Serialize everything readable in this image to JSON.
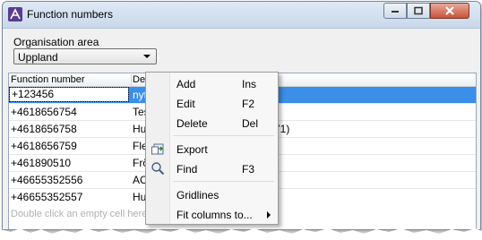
{
  "window": {
    "title": "Function numbers"
  },
  "org": {
    "label": "Organisation area",
    "selected": "Uppland"
  },
  "grid": {
    "col1": "Function number",
    "col2": "Des",
    "rows": [
      {
        "number": "+123456",
        "desc": "nyt"
      },
      {
        "number": "+4618656754",
        "desc": "Tes"
      },
      {
        "number": "+4618656758",
        "desc": "Hur"
      },
      {
        "number": "+4618656759",
        "desc": "Flex"
      },
      {
        "number": "+461890510",
        "desc": "Frö"
      },
      {
        "number": "+46655352556",
        "desc": "ACD"
      },
      {
        "number": "+46655352557",
        "desc": "Hur"
      }
    ],
    "extra_text": "71)",
    "hint": "Double click an empty cell here t"
  },
  "menu": {
    "items": [
      {
        "label": "Add",
        "shortcut": "Ins"
      },
      {
        "label": "Edit",
        "shortcut": "F2"
      },
      {
        "label": "Delete",
        "shortcut": "Del"
      },
      {
        "label": "Export",
        "shortcut": ""
      },
      {
        "label": "Find",
        "shortcut": "F3"
      },
      {
        "label": "Gridlines",
        "shortcut": ""
      },
      {
        "label": "Fit columns to...",
        "shortcut": ""
      }
    ],
    "icons": {
      "export": "export-icon",
      "find": "magnifier-icon"
    }
  },
  "colors": {
    "selection": "#3b8fe8",
    "titlebar": "#dfe9f5"
  }
}
